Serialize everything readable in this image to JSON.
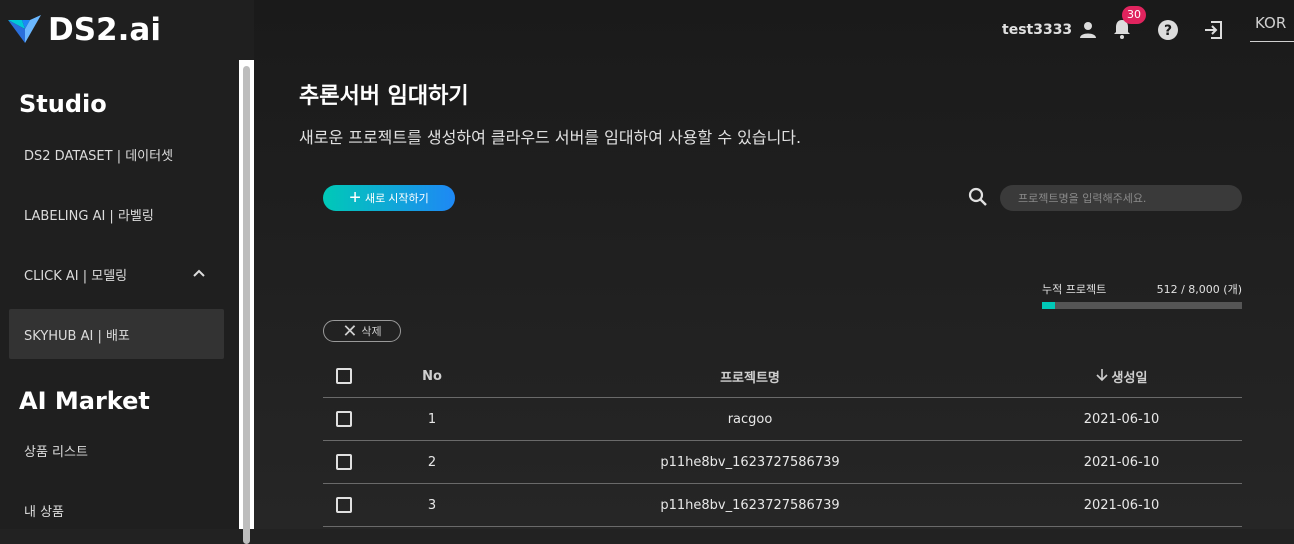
{
  "brand": {
    "name": "DS2.ai"
  },
  "sidebar": {
    "studio_title": "Studio",
    "studio_items": [
      {
        "label": "DS2 DATASET | 데이터셋"
      },
      {
        "label": "LABELING AI | 라벨링"
      },
      {
        "label": "CLICK AI | 모델링"
      },
      {
        "label": "SKYHUB AI | 배포"
      }
    ],
    "market_title": "AI Market",
    "market_items": [
      {
        "label": "상품 리스트"
      },
      {
        "label": "내 상품"
      }
    ],
    "active_item": "SKYHUB AI | 배포"
  },
  "header": {
    "username": "test3333",
    "notification_count": "30",
    "language": "KOR",
    "icons": [
      "user-icon",
      "bell-icon",
      "help-icon",
      "logout-icon"
    ]
  },
  "page": {
    "title": "추론서버 임대하기",
    "description": "새로운 프로젝트를 생성하여 클라우드 서버를 임대하여 사용할 수 있습니다.",
    "new_button": "새로 시작하기",
    "search_placeholder": "프로젝트명을 입력해주세요.",
    "progress_label": "누적 프로젝트",
    "progress_count": "512 / 8,000 (개)",
    "progress_fraction": 0.064,
    "delete_button": "삭제"
  },
  "table": {
    "headers": {
      "no": "No",
      "name": "프로젝트명",
      "date": "생성일"
    },
    "rows": [
      {
        "no": "1",
        "name": "racgoo",
        "date": "2021-06-10"
      },
      {
        "no": "2",
        "name": "p11he8bv_1623727586739",
        "date": "2021-06-10"
      },
      {
        "no": "3",
        "name": "p11he8bv_1623727586739",
        "date": "2021-06-10"
      }
    ]
  },
  "colors": {
    "accent_start": "#00c9b7",
    "accent_end": "#1e88f5",
    "badge": "#e0245e"
  }
}
